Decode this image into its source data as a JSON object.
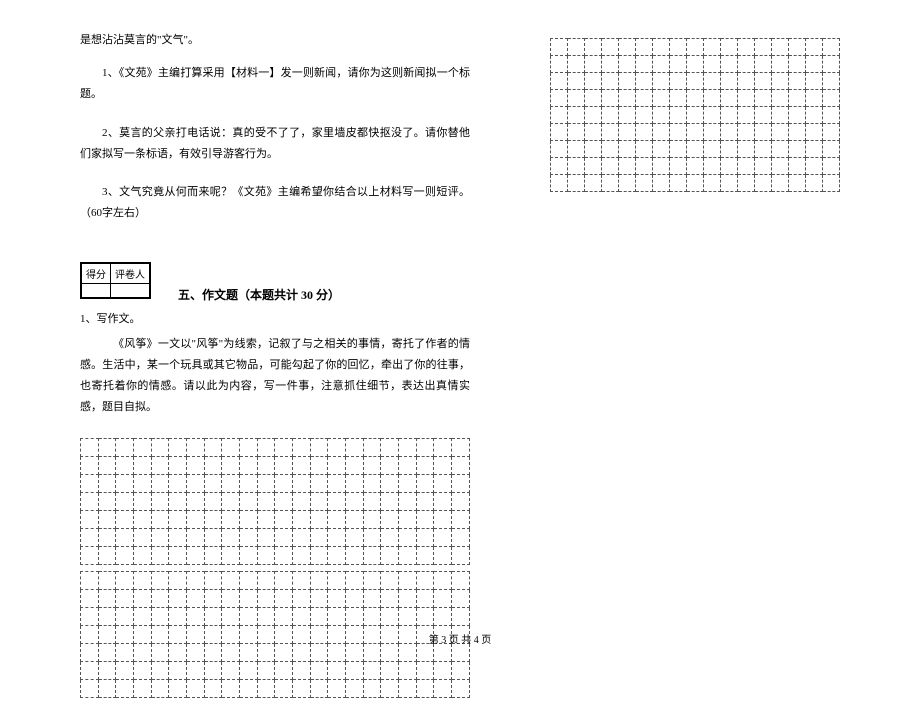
{
  "intro_line": "是想沾沾莫言的\"文气\"。",
  "q1": "1、《文苑》主编打算采用【材料一】发一则新闻，请你为这则新闻拟一个标题。",
  "q2": "2、莫言的父亲打电话说：真的受不了了，家里墙皮都快抠没了。请你替他们家拟写一条标语，有效引导游客行为。",
  "q3": "3、文气究竟从何而来呢？《文苑》主编希望你结合以上材料写一则短评。（60字左右）",
  "scorebox": {
    "col1": "得分",
    "col2": "评卷人"
  },
  "section5_title": "五、作文题（本题共计 30 分）",
  "essay": {
    "num": "1、写作文。",
    "p1": "《风筝》一文以\"风筝\"为线索，记叙了与之相关的事情，寄托了作者的情感。生活中，某一个玩具或其它物品，可能勾起了你的回忆，牵出了你的往事，也寄托着你的情感。请以此为内容，写一件事，注意抓住细节，表达出真情实感，题目自拟。"
  },
  "footer": "第 3 页 共 4 页"
}
